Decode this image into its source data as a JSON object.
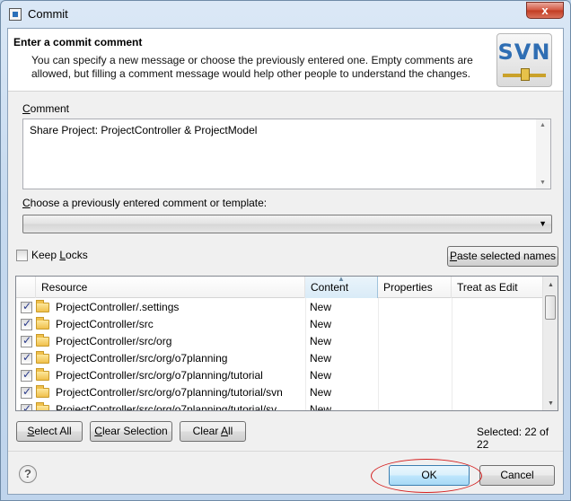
{
  "window": {
    "title": "Commit",
    "close_glyph": "x"
  },
  "header": {
    "title": "Enter a commit comment",
    "description": "You can specify a new message or choose the previously entered one. Empty comments are allowed, but filling a comment message would help other people to understand the changes.",
    "logo_text": "SVN"
  },
  "comment": {
    "label_mnemonic": "C",
    "label_rest": "omment",
    "value": "Share Project: ProjectController & ProjectModel"
  },
  "template": {
    "label_mnemonic": "C",
    "label_rest": "hoose a previously entered comment or template:",
    "selected": ""
  },
  "options": {
    "keep_locks_pre": "Keep ",
    "keep_locks_mnemonic": "L",
    "keep_locks_post": "ocks",
    "keep_locks_checked": false,
    "paste_pre": "",
    "paste_mnemonic": "P",
    "paste_post": "aste selected names"
  },
  "table": {
    "columns": [
      "Resource",
      "Content",
      "Properties",
      "Treat as Edit"
    ],
    "sorted_column": "Content",
    "rows": [
      {
        "resource": "ProjectController/.settings",
        "content": "New",
        "properties": "",
        "treat_as_edit": "",
        "checked": true
      },
      {
        "resource": "ProjectController/src",
        "content": "New",
        "properties": "",
        "treat_as_edit": "",
        "checked": true
      },
      {
        "resource": "ProjectController/src/org",
        "content": "New",
        "properties": "",
        "treat_as_edit": "",
        "checked": true
      },
      {
        "resource": "ProjectController/src/org/o7planning",
        "content": "New",
        "properties": "",
        "treat_as_edit": "",
        "checked": true
      },
      {
        "resource": "ProjectController/src/org/o7planning/tutorial",
        "content": "New",
        "properties": "",
        "treat_as_edit": "",
        "checked": true
      },
      {
        "resource": "ProjectController/src/org/o7planning/tutorial/svn",
        "content": "New",
        "properties": "",
        "treat_as_edit": "",
        "checked": true
      },
      {
        "resource": "ProjectController/src/org/o7planning/tutorial/sv",
        "content": "New",
        "properties": "",
        "treat_as_edit": "",
        "checked": true
      }
    ],
    "scroll_fraction": 0.0
  },
  "selection_buttons": {
    "select_all_mnemonic": "S",
    "select_all_rest": "elect All",
    "clear_selection_pre": "",
    "clear_selection_mnemonic": "C",
    "clear_selection_rest": "lear Selection",
    "clear_all_pre": "Clear ",
    "clear_all_mnemonic": "A",
    "clear_all_rest": "ll"
  },
  "status": {
    "selected_count": "Selected: 22 of 22"
  },
  "footer": {
    "help_glyph": "?",
    "ok_label": "OK",
    "cancel_label": "Cancel"
  },
  "colors": {
    "title_bar": "#c6daef",
    "close_button": "#c23b22",
    "highlight_ellipse": "#d42020",
    "svn_logo_text": "#2f6eb3"
  }
}
